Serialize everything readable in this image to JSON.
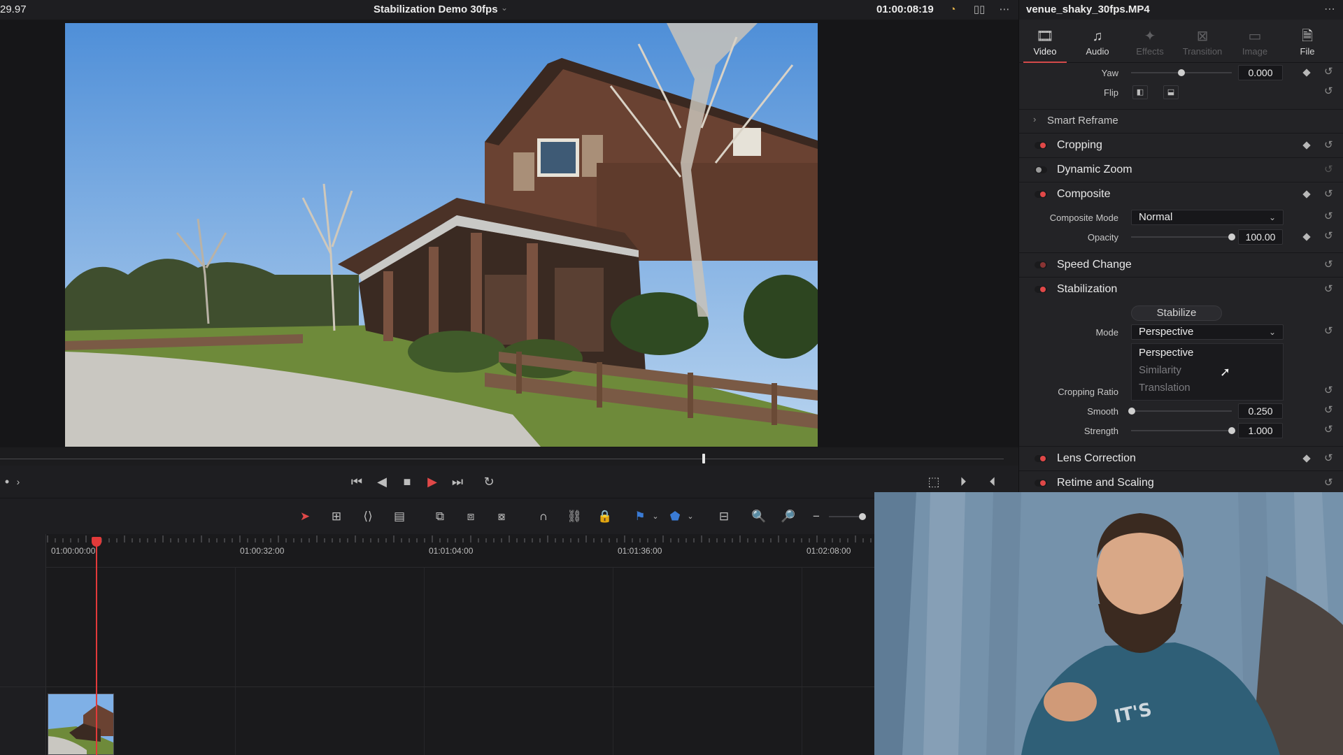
{
  "topbar": {
    "frame_rate": "29.97",
    "project_title": "Stabilization Demo 30fps",
    "timecode": "01:00:08:19"
  },
  "inspector": {
    "clip_name": "venue_shaky_30fps.MP4",
    "tabs": [
      {
        "label": "Video",
        "icon": "film-icon",
        "active": true
      },
      {
        "label": "Audio",
        "icon": "music-note-icon",
        "active": false
      },
      {
        "label": "Effects",
        "icon": "wand-icon",
        "active": false,
        "disabled": true
      },
      {
        "label": "Transition",
        "icon": "transition-icon",
        "active": false,
        "disabled": true
      },
      {
        "label": "Image",
        "icon": "image-icon",
        "active": false,
        "disabled": true
      },
      {
        "label": "File",
        "icon": "file-icon",
        "active": false
      }
    ],
    "transform": {
      "yaw_label": "Yaw",
      "yaw_value": "0.000",
      "flip_label": "Flip"
    },
    "smart_reframe": "Smart Reframe",
    "sections": {
      "cropping": "Cropping",
      "dynamic_zoom": "Dynamic Zoom",
      "composite": "Composite",
      "speed_change": "Speed Change",
      "stabilization": "Stabilization",
      "lens_correction": "Lens Correction",
      "retime_scaling": "Retime and Scaling"
    },
    "composite": {
      "mode_label": "Composite Mode",
      "mode_value": "Normal",
      "opacity_label": "Opacity",
      "opacity_value": "100.00",
      "opacity_level": 1.0
    },
    "stabilization": {
      "stabilize_button": "Stabilize",
      "mode_label": "Mode",
      "mode_value": "Perspective",
      "mode_options": [
        "Perspective",
        "Similarity",
        "Translation"
      ],
      "cropping_ratio_label": "Cropping Ratio",
      "smooth_label": "Smooth",
      "smooth_value": "0.250",
      "strength_label": "Strength",
      "strength_value": "1.000"
    }
  },
  "timeline": {
    "ruler_labels": [
      "01:00:00:00",
      "01:00:32:00",
      "01:01:04:00",
      "01:01:36:00",
      "01:02:08:00"
    ]
  },
  "colors": {
    "accent_red": "#e04848",
    "panel_bg": "#232326"
  }
}
